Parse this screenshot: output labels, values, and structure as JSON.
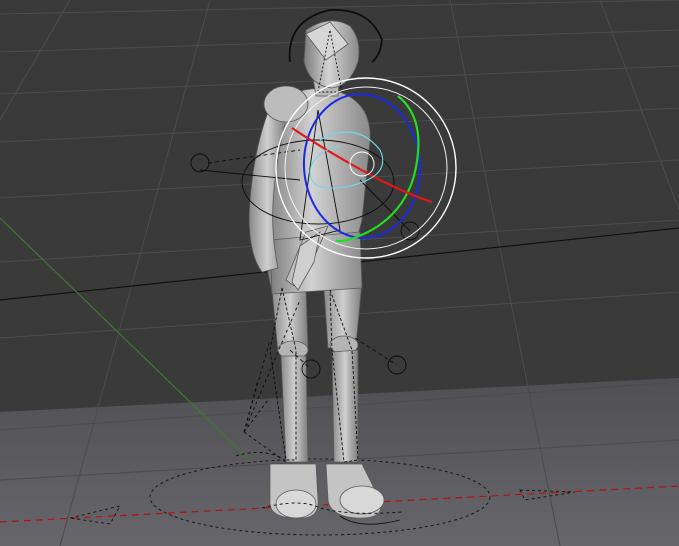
{
  "viewport": {
    "view_type": "3D viewport",
    "shading_mode": "solid",
    "colors": {
      "background": "#3a3a3a",
      "floor": "#5b5b5f",
      "grid_line": "#4a4a4a",
      "axis_x": "#b01515",
      "axis_y": "#3b7a2c",
      "mesh_light": "#c9c9c9",
      "mesh_mid": "#9a9a9a",
      "mesh_dark": "#6f6f6f",
      "armature_line": "#0d0d0d",
      "gizmo_view_ring": "#ffffff",
      "gizmo_x": "#e01818",
      "gizmo_y": "#22dd22",
      "gizmo_z": "#1a2ae0",
      "gizmo_trackball": "#6fd9e8"
    }
  },
  "scene": {
    "objects": [
      {
        "name": "character-mesh",
        "type": "mesh"
      },
      {
        "name": "armature",
        "type": "armature",
        "mode": "pose"
      }
    ],
    "manipulator": {
      "type": "rotate",
      "axes": [
        "x",
        "y",
        "z",
        "view",
        "trackball"
      ]
    }
  }
}
